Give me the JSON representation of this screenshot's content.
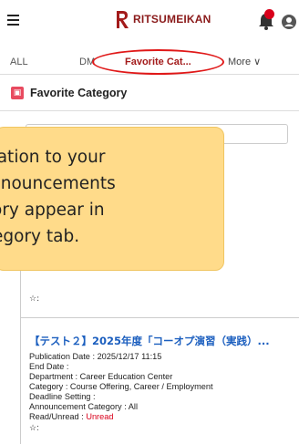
{
  "header": {
    "logo_text": "RITSUMEIKAN",
    "brand_color": "#8a1a1a",
    "notification_color": "#d9001b"
  },
  "tabs": {
    "all": "ALL",
    "dm": "DM",
    "favorite": "Favorite Cat...",
    "more": "More ∨"
  },
  "section": {
    "title": "Favorite Category"
  },
  "tooltip": {
    "line1": "nation to your",
    "line2": "nnouncements",
    "line3": "ory appear in",
    "line4": "egory tab."
  },
  "first_item": {
    "star": "☆:"
  },
  "second_item": {
    "title": "【テスト２】2025年度「コーオプ演習（実践）...",
    "publication_date": "Publication Date : 2025/12/17 11:15",
    "end_date": "End Date :",
    "department": "Department : Career Education Center",
    "category": "Category : Course Offering, Career / Employment",
    "deadline": "Deadline Setting :",
    "announcement_category": "Announcement Category : All",
    "read_label": "Read/Unread : ",
    "read_value": "Unread",
    "star": "☆:"
  }
}
